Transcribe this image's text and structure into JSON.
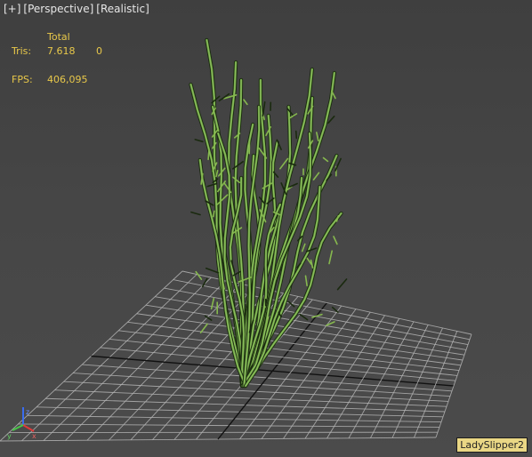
{
  "viewport_menu": {
    "plus": "[+]",
    "view": "[Perspective]",
    "shading": "[Realistic]"
  },
  "stats": {
    "total_header": "Total",
    "tris_label": "Tris:",
    "tris_total": "7.618",
    "tris_selected": "0",
    "fps_label": "FPS:",
    "fps_value": "406,095"
  },
  "gizmo": {
    "x_label": "x",
    "y_label": "y",
    "z_label": "z"
  },
  "colors": {
    "grid_line": "#b4b4b4",
    "grid_axis": "#111111",
    "stats_text": "#e8c84a",
    "stem_dark": "#1a2a0f",
    "stem_light": "#6fa347",
    "label_bg": "#ead785"
  },
  "selected_object": "LadySlipper2"
}
